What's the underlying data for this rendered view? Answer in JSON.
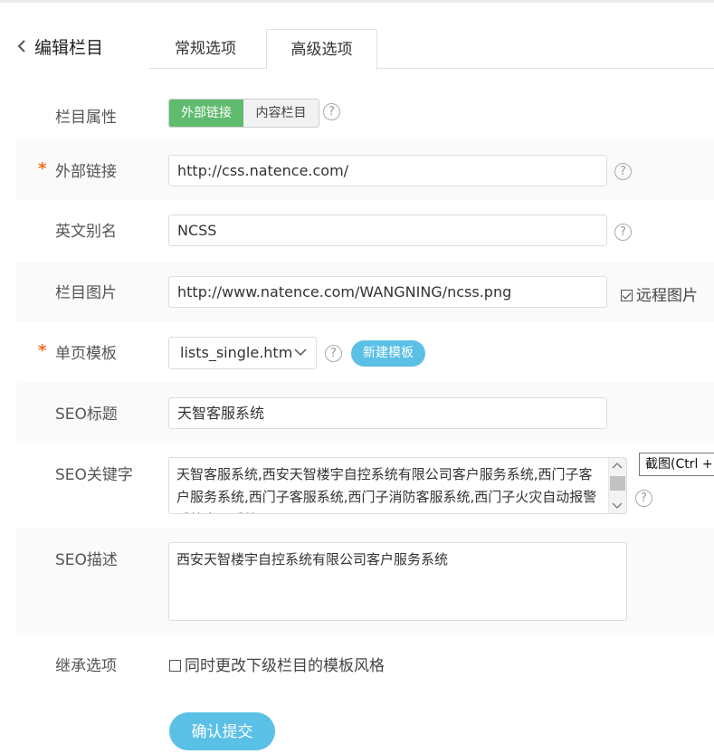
{
  "header": {
    "back_label": "编辑栏目",
    "tabs": [
      {
        "label": "常规选项",
        "active": false
      },
      {
        "label": "高级选项",
        "active": true
      }
    ]
  },
  "form": {
    "column_type": {
      "label": "栏目属性",
      "options": [
        "外部链接",
        "内容栏目"
      ],
      "selected": "外部链接"
    },
    "external_link": {
      "label": "外部链接",
      "required": "*",
      "value": "http://css.natence.com/"
    },
    "english_alias": {
      "label": "英文别名",
      "value": "NCSS"
    },
    "column_image": {
      "label": "栏目图片",
      "value": "http://www.natence.com/WANGNING/ncss.png",
      "remote_label": "远程图片",
      "remote_checked": true
    },
    "single_template": {
      "label": "单页模板",
      "required": "*",
      "selected": "lists_single.htm",
      "new_button": "新建模板"
    },
    "seo_title": {
      "label": "SEO标题",
      "value": "天智客服系统"
    },
    "seo_keywords": {
      "label": "SEO关键字",
      "value": "天智客服系统,西安天智楼宇自控系统有限公司客户服务系统,西门子客户服务系统,西门子客服系统,西门子消防客服系统,西门子火灾自动报警系统客服系统"
    },
    "seo_description": {
      "label": "SEO描述",
      "value": "西安天智楼宇自控系统有限公司客户服务系统"
    },
    "inherit": {
      "label": "继承选项",
      "checkbox_label": "同时更改下级栏目的模板风格",
      "checked": false
    },
    "submit_label": "确认提交"
  },
  "tooltip": {
    "text": "截图(Ctrl +"
  },
  "colors": {
    "green_active": "#5fbb6e",
    "accent_blue": "#5bc0e6",
    "required_orange": "#f26b1d"
  },
  "icons": {
    "help": "?"
  }
}
